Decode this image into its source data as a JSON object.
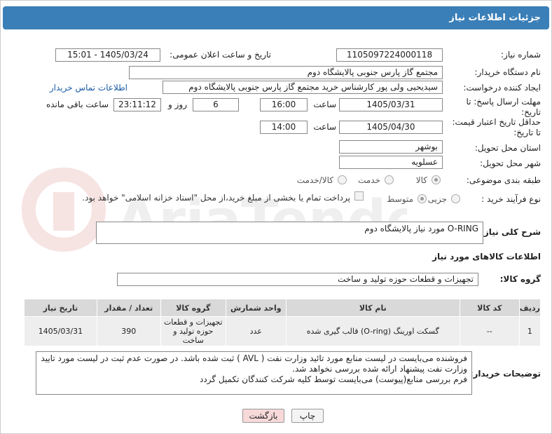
{
  "header": {
    "title": "جزئیات اطلاعات نیاز"
  },
  "fields": {
    "need_number_label": "شماره نیاز:",
    "need_number": "1105097224000118",
    "announce_label": "تاریخ و ساعت اعلان عمومی:",
    "announce_value": "1405/03/24 - 15:01",
    "buyer_org_label": "نام دستگاه خریدار:",
    "buyer_org": "مجتمع گاز پارس جنوبی  پالایشگاه دوم",
    "requester_label": "ایجاد کننده درخواست:",
    "requester": "سیدیحیی ولی پور کارشناس خرید مجتمع گاز پارس جنوبی  پالایشگاه دوم",
    "contact_link": "اطلاعات تماس خریدار",
    "reply_deadline_label": "مهلت ارسال پاسخ: تا تاریخ:",
    "reply_date": "1405/03/31",
    "time_label": "ساعت",
    "reply_time": "16:00",
    "days": "6",
    "days_label": "روز و",
    "remaining_time": "23:11:12",
    "remaining_label": "ساعت باقی مانده",
    "price_validity_label": "حداقل تاریخ اعتبار قیمت: تا تاریخ:",
    "price_date": "1405/04/30",
    "price_time_label": "ساعت",
    "price_time": "14:00",
    "province_label": "استان محل تحویل:",
    "province": "بوشهر",
    "city_label": "شهر محل تحویل:",
    "city": "عسلویه",
    "category_label": "طبقه بندی موضوعی:",
    "category_options": [
      "کالا",
      "خدمت",
      "کالا/خدمت"
    ],
    "process_label": "نوع فرآیند خرید :",
    "process_options": [
      "جزیی",
      "متوسط"
    ],
    "payment_note": "پرداخت تمام یا بخشی از مبلغ خرید،از محل \"اسناد خزانه اسلامی\" خواهد بود."
  },
  "description": {
    "label": "شرح کلی نیاز:",
    "value": "O-RING مورد نیاز پالایشگاه دوم"
  },
  "goods": {
    "section_title": "اطلاعات کالاهای مورد نیاز",
    "group_label": "گروه کالا:",
    "group_value": "تجهیزات و قطعات حوزه تولید و ساخت",
    "columns": [
      "ردیف",
      "کد کالا",
      "نام کالا",
      "واحد شمارش",
      "گروه کالا",
      "تعداد / مقدار",
      "تاریخ نیاز"
    ],
    "rows": [
      [
        "1",
        "--",
        "گسکت اورینگ (O-ring) قالب گیری شده",
        "عدد",
        "تجهیزات و قطعات حوزه تولید و ساخت",
        "390",
        "1405/03/31"
      ]
    ]
  },
  "buyer_notes": {
    "label": "توضیحات خریدار:",
    "lines": [
      "فروشنده می‌بایست در لیست منابع مورد تائید وزارت نفت ( AVL ) ثبت شده باشد. در صورت عدم ثبت در لیست مورد تایید",
      "وزارت نفت پیشنهاد ارائه شده بررسی نخواهد شد.",
      "فرم بررسی منابع(پیوست) می‌بایست توسط کلیه شرکت کنندگان تکمیل گردد"
    ]
  },
  "buttons": {
    "print": "چاپ",
    "back": "بازگشت"
  },
  "watermark_text": "AriaTender.net",
  "colors": {
    "header": "#3a7fb8",
    "back_button": "#f7d9d9",
    "link": "#1a5ca8"
  }
}
